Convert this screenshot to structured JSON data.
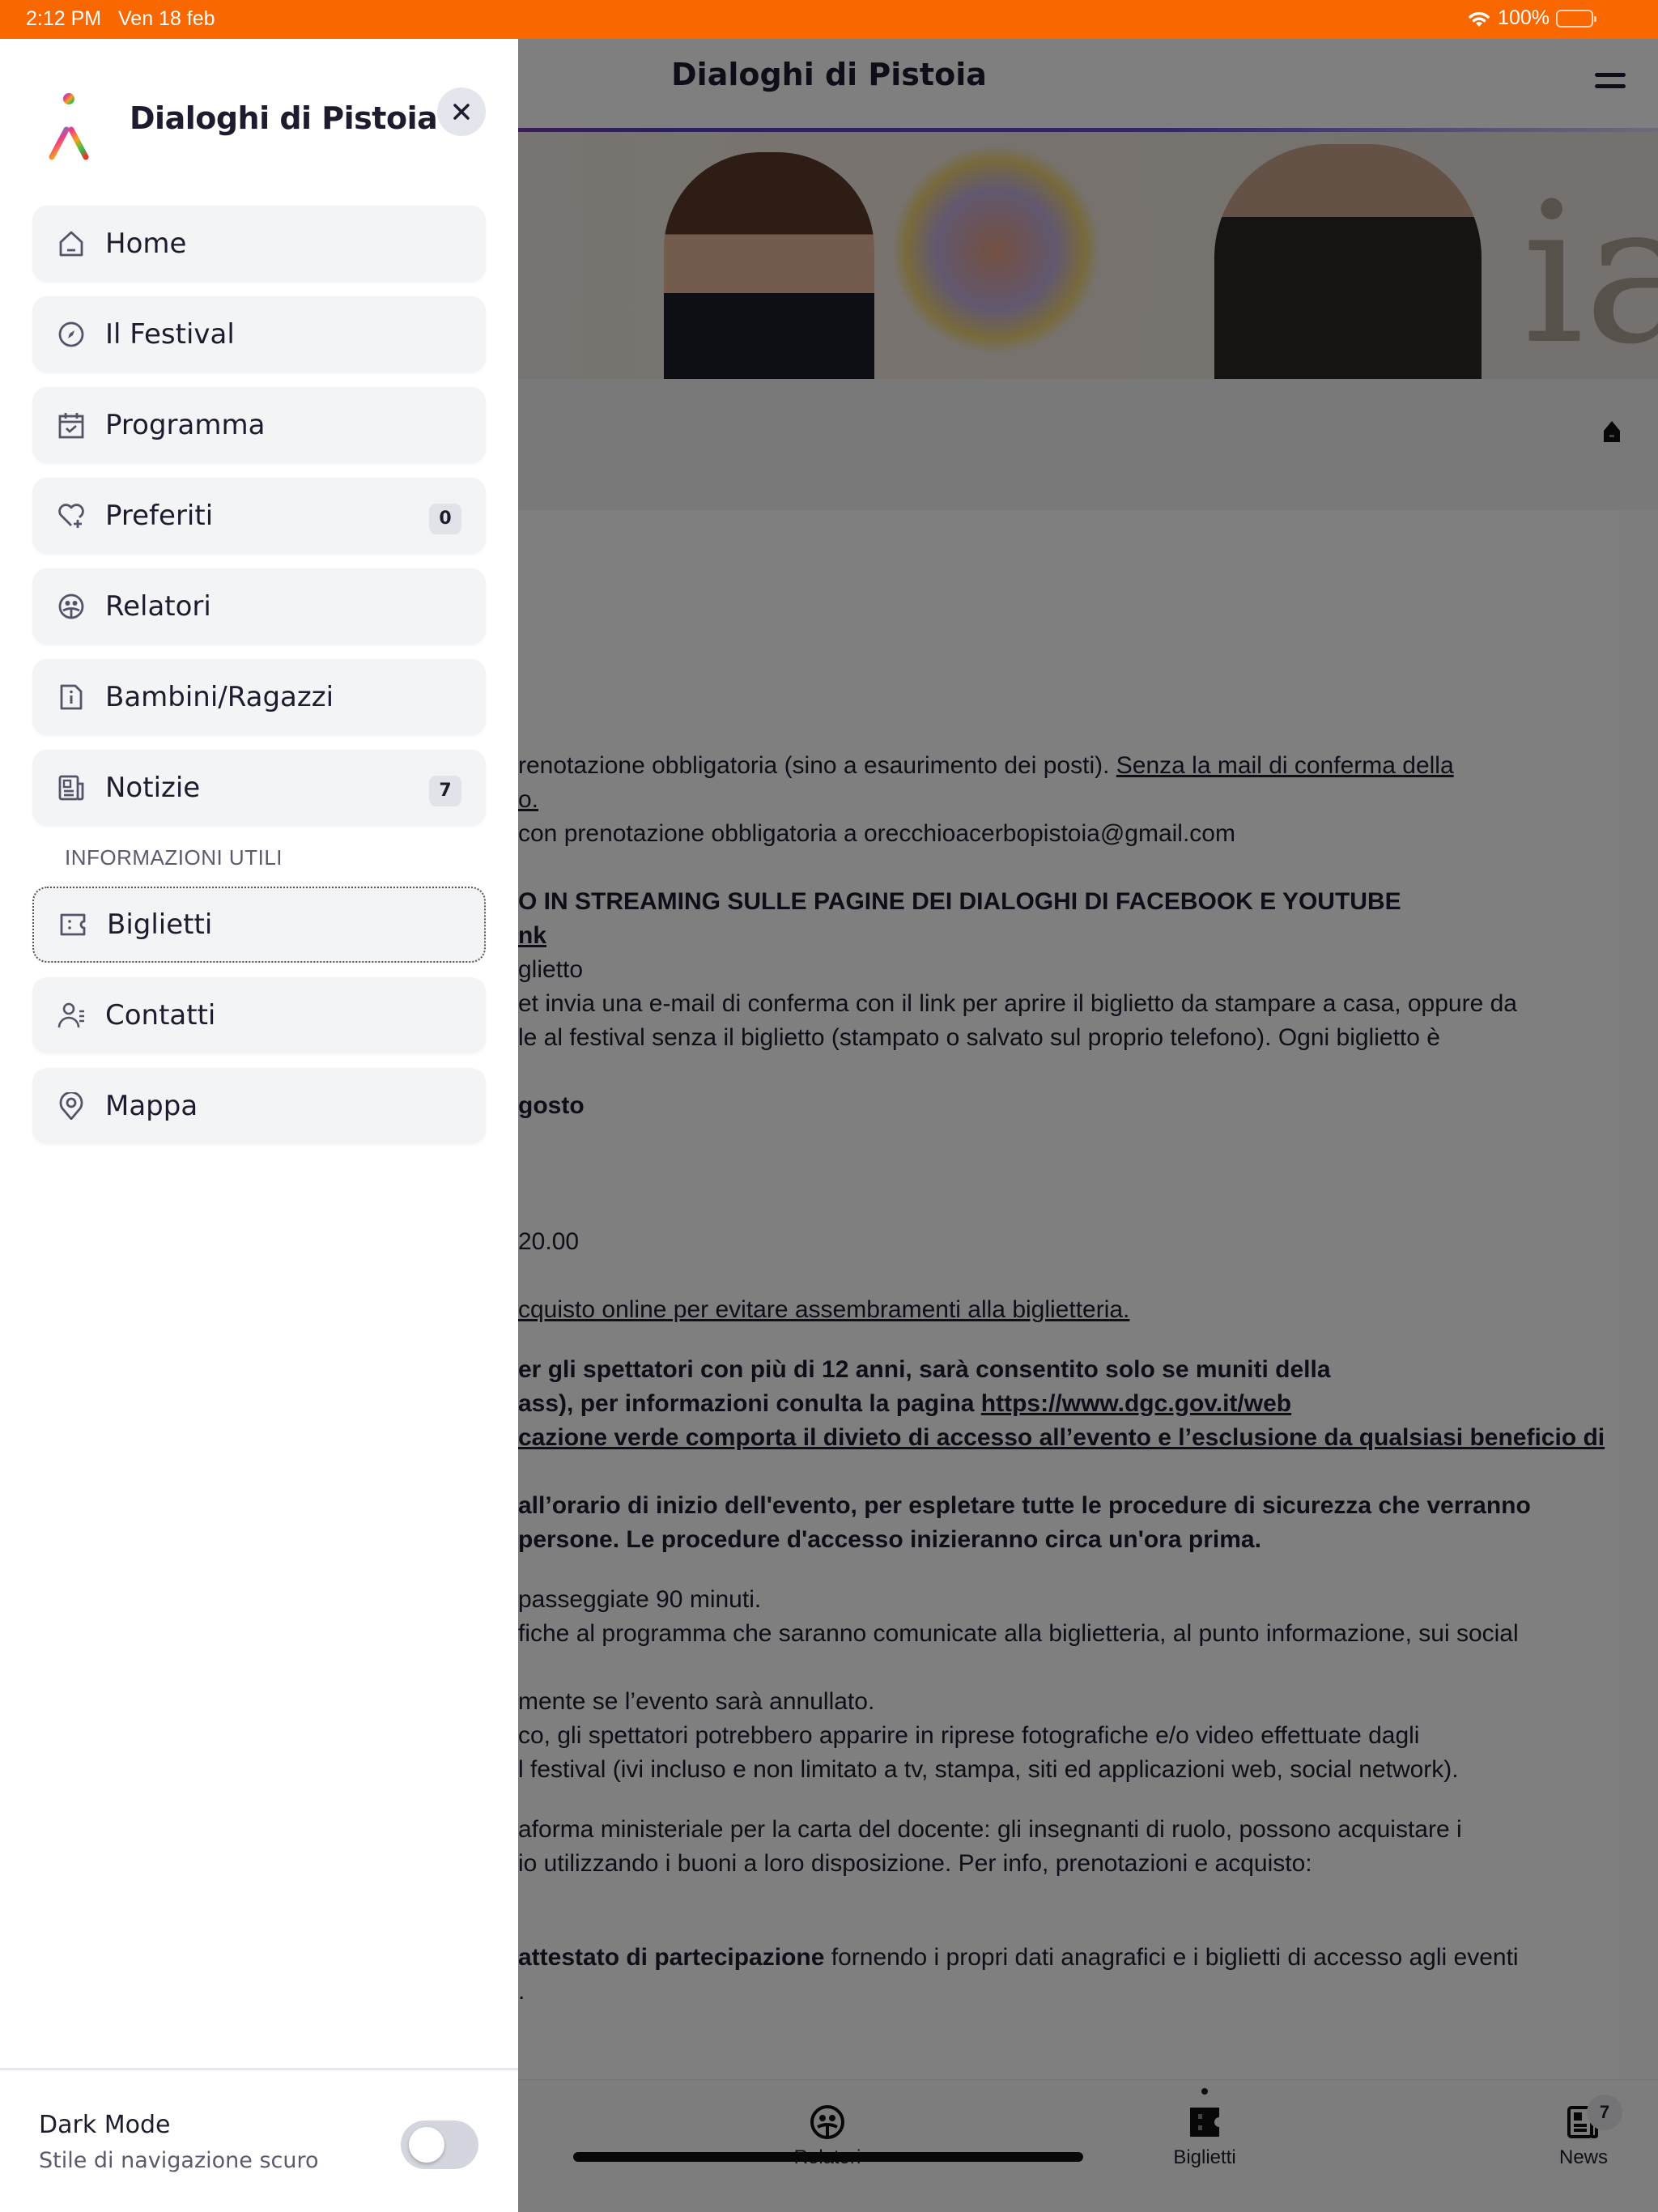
{
  "status_bar": {
    "time": "2:12 PM",
    "date": "Ven 18 feb",
    "battery": "100%",
    "wifi_icon": "wifi-icon",
    "battery_icon": "battery-icon"
  },
  "colors": {
    "status_bar": "#f96700",
    "drawer_bg": "#ffffff",
    "nav_item_bg": "#f3f4f6",
    "text_primary": "#1e1b2e",
    "text_secondary": "#5c5a6e"
  },
  "drawer": {
    "title": "Dialoghi di Pistoia",
    "logo_icon": "festival-figure-logo",
    "close_icon": "close-icon",
    "items": [
      {
        "label": "Home",
        "icon": "home-icon"
      },
      {
        "label": "Il Festival",
        "icon": "compass-icon"
      },
      {
        "label": "Programma",
        "icon": "calendar-check-icon"
      },
      {
        "label": "Preferiti",
        "icon": "heart-plus-icon",
        "badge": "0"
      },
      {
        "label": "Relatori",
        "icon": "speakers-face-icon"
      },
      {
        "label": "Bambini/Ragazzi",
        "icon": "info-document-icon"
      },
      {
        "label": "Notizie",
        "icon": "newspaper-icon",
        "badge": "7"
      }
    ],
    "section_label": "INFORMAZIONI UTILI",
    "info_items": [
      {
        "label": "Biglietti",
        "icon": "ticket-icon",
        "active": true
      },
      {
        "label": "Contatti",
        "icon": "contacts-icon"
      },
      {
        "label": "Mappa",
        "icon": "map-pin-icon"
      }
    ],
    "dark_mode": {
      "title": "Dark Mode",
      "subtitle": "Stile di navigazione scuro",
      "enabled": false
    }
  },
  "page": {
    "header_title": "Dialoghi di Pistoia",
    "menu_icon": "hamburger-icon",
    "breadcrumb_icon": "home-icon",
    "content_lines": [
      {
        "parts": [
          {
            "text": "renotazione obbligatoria (sino a esaurimento dei posti). "
          },
          {
            "text": "Senza la mail di conferma della",
            "style": "u"
          }
        ]
      },
      {
        "parts": [
          {
            "text": "o.",
            "style": "u"
          }
        ]
      },
      {
        "parts": [
          {
            "text": "con prenotazione obbligatoria a orecchioacerbopistoia@gmail.com"
          }
        ]
      },
      {
        "parts": [
          {
            "text": "O IN STREAMING SULLE PAGINE DEI DIALOGHI DI FACEBOOK E YOUTUBE",
            "style": "b"
          }
        ]
      },
      {
        "parts": [
          {
            "text": "nk",
            "style": "bu"
          }
        ]
      },
      {
        "parts": [
          {
            "text": "glietto"
          }
        ]
      },
      {
        "parts": [
          {
            "text": "et invia una e-mail di conferma con il link per aprire il biglietto da stampare a casa, oppure da"
          }
        ]
      },
      {
        "parts": [
          {
            "text": "le al festival senza il biglietto (stampato o salvato sul proprio telefono). Ogni biglietto è"
          }
        ]
      },
      {
        "parts": [
          {
            "text": "gosto",
            "style": "b"
          }
        ]
      },
      {
        "parts": [
          {
            "text": "20.00"
          }
        ]
      },
      {
        "parts": [
          {
            "text": "cquisto online per evitare assembramenti alla biglietteria.",
            "style": "u"
          }
        ]
      },
      {
        "parts": [
          {
            "text": "er gli spettatori con più di 12 anni, sarà consentito solo se muniti della",
            "style": "b"
          }
        ]
      },
      {
        "parts": [
          {
            "text": "ass), per informazioni conulta la pagina ",
            "style": "b"
          },
          {
            "text": "https://www.dgc.gov.it/web",
            "style": "bu"
          }
        ]
      },
      {
        "parts": [
          {
            "text": "cazione verde comporta il divieto di accesso all’evento e l’esclusione da qualsiasi beneficio di",
            "style": "bu"
          }
        ]
      },
      {
        "parts": [
          {
            "text": "all’orario di inizio dell'evento, per espletare tutte le procedure di sicurezza che verranno",
            "style": "b"
          }
        ]
      },
      {
        "parts": [
          {
            "text": "persone. Le procedure d'accesso inizieranno circa un'ora prima.",
            "style": "b"
          }
        ]
      },
      {
        "parts": [
          {
            "text": " passeggiate 90 minuti."
          }
        ]
      },
      {
        "parts": [
          {
            "text": "fiche al programma che saranno comunicate alla biglietteria, al punto informazione, sui social"
          }
        ]
      },
      {
        "parts": [
          {
            "text": "mente se l’evento sarà annullato."
          }
        ]
      },
      {
        "parts": [
          {
            "text": "co, gli spettatori potrebbero apparire in riprese fotografiche e/o video effettuate dagli"
          }
        ]
      },
      {
        "parts": [
          {
            "text": "l festival (ivi incluso e non limitato a tv, stampa, siti ed applicazioni web, social network)."
          }
        ]
      },
      {
        "parts": [
          {
            "text": "aforma ministeriale per la carta del docente: gli insegnanti di ruolo, possono acquistare i"
          }
        ]
      },
      {
        "parts": [
          {
            "text": "io utilizzando i buoni a loro disposizione. Per info, prenotazioni e acquisto:"
          }
        ]
      },
      {
        "parts": [
          {
            "text": "attestato di partecipazione",
            "style": "b"
          },
          {
            "text": " fornendo i propri dati anagrafici e i biglietti di accesso agli eventi"
          }
        ]
      },
      {
        "parts": [
          {
            "text": "."
          }
        ]
      }
    ],
    "tabbar": [
      {
        "label": "Relatori",
        "icon": "speakers-face-icon"
      },
      {
        "label": "Biglietti",
        "icon": "ticket-icon",
        "active": true
      },
      {
        "label": "News",
        "icon": "newspaper-icon",
        "badge": "7"
      }
    ]
  }
}
